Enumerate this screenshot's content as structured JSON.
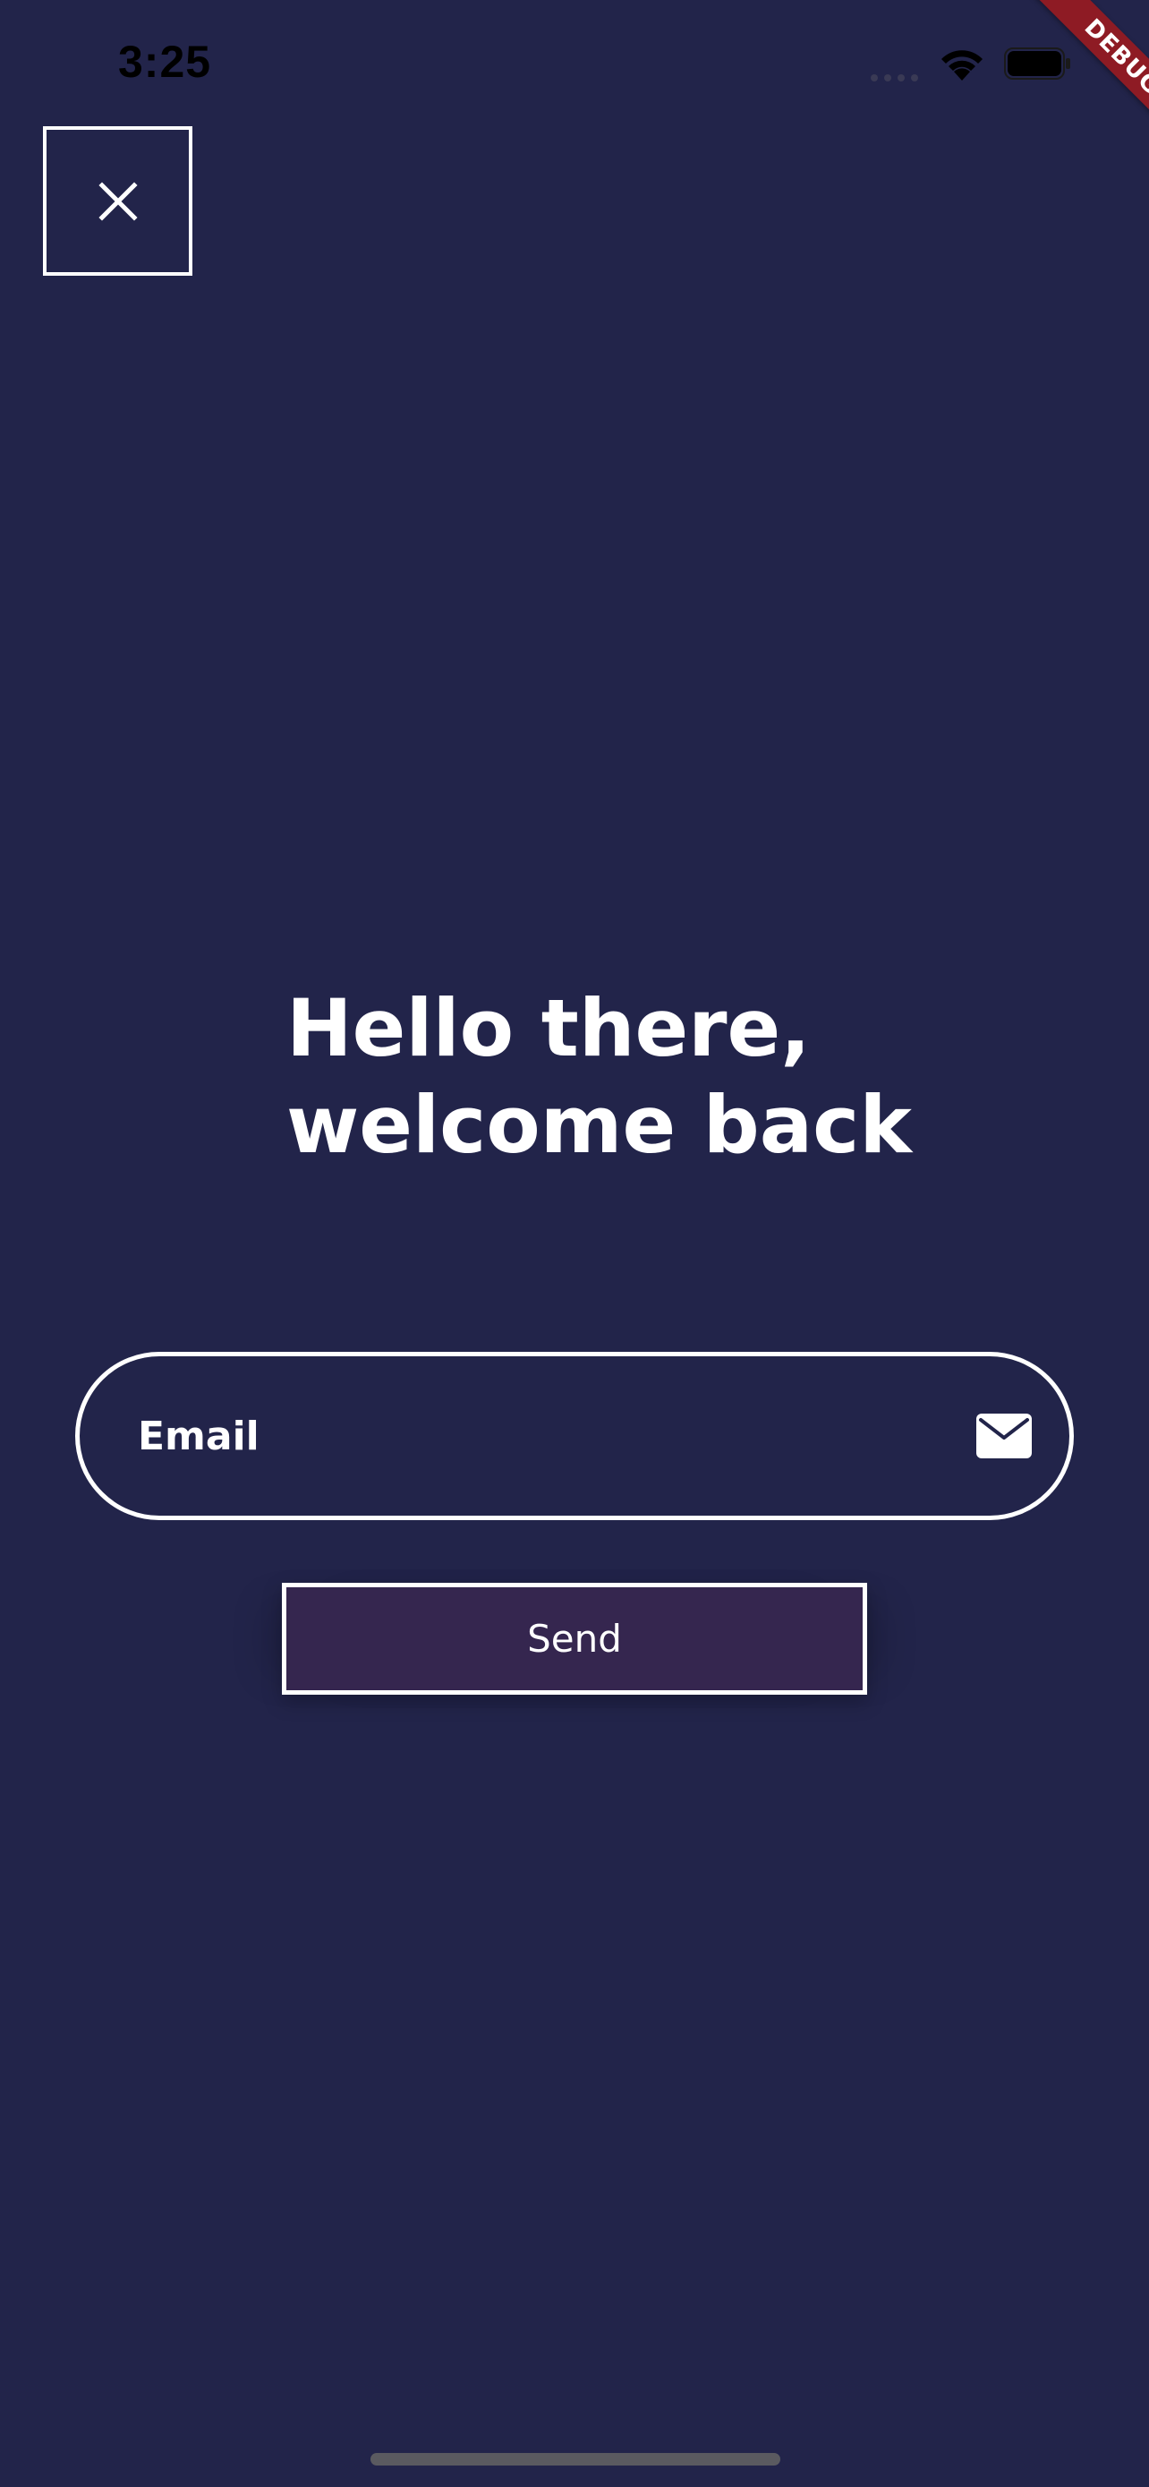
{
  "status_bar": {
    "time": "3:25"
  },
  "debug_banner": {
    "label": "DEBUG",
    "color": "#8e1b24"
  },
  "close_button": {
    "icon": "close-icon"
  },
  "headline": {
    "line1": "Hello there,",
    "line2": "welcome back"
  },
  "email_field": {
    "placeholder": "Email",
    "value": "",
    "icon": "mail-icon"
  },
  "send_button": {
    "label": "Send"
  },
  "colors": {
    "background": "#22244a",
    "button_fill": "#35264f",
    "foreground": "#ffffff"
  }
}
